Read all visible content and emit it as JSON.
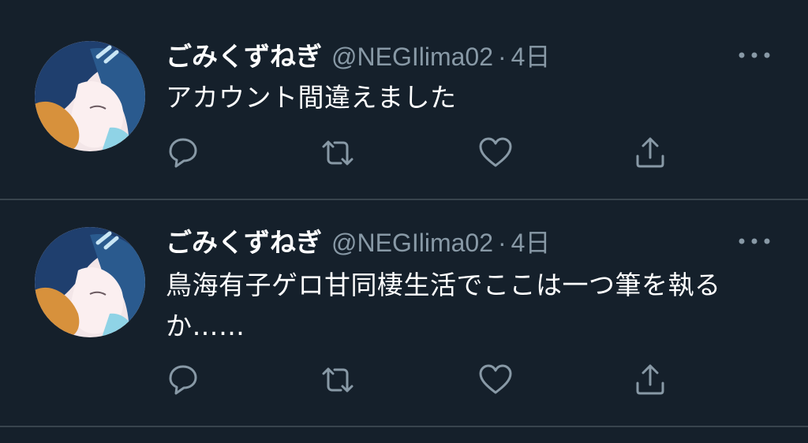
{
  "colors": {
    "background": "#15202b",
    "text_primary": "#ffffff",
    "text_secondary": "#8899a6",
    "divider": "#38444d"
  },
  "tweets": [
    {
      "display_name": "ごみくずねぎ",
      "handle": "@NEGIlima02",
      "separator": "·",
      "time": "4日",
      "text": "アカウント間違えました",
      "icons": [
        "avatar-image",
        "more-icon",
        "reply-icon",
        "retweet-icon",
        "like-icon",
        "share-icon"
      ]
    },
    {
      "display_name": "ごみくずねぎ",
      "handle": "@NEGIlima02",
      "separator": "·",
      "time": "4日",
      "text": "鳥海有子ゲロ甘同棲生活でここは一つ筆を執るか……",
      "icons": [
        "avatar-image",
        "more-icon",
        "reply-icon",
        "retweet-icon",
        "like-icon",
        "share-icon"
      ]
    }
  ]
}
